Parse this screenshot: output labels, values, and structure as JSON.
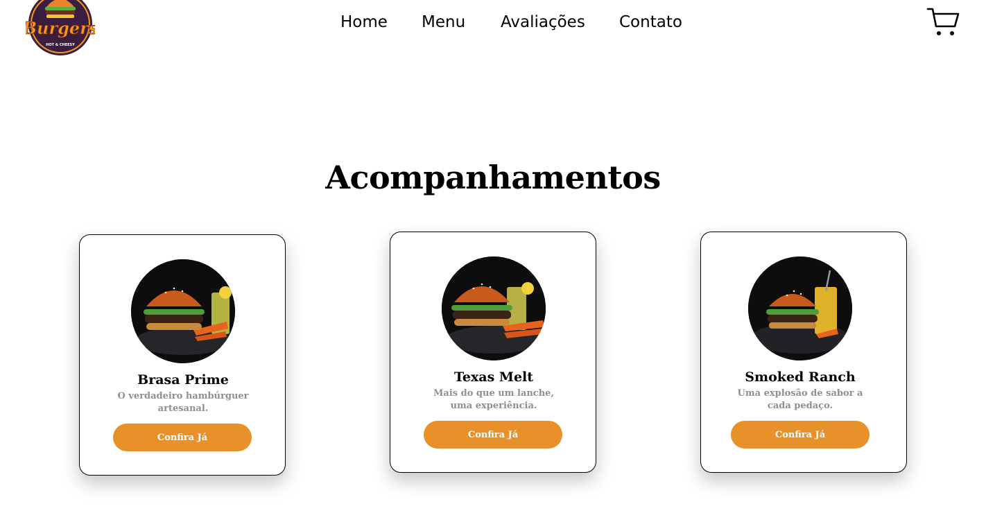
{
  "brand": {
    "logo_text": "Burgers",
    "logo_tagline": "HOT & CHEESY"
  },
  "nav": {
    "items": [
      {
        "label": "Home"
      },
      {
        "label": "Menu"
      },
      {
        "label": "Avaliações"
      },
      {
        "label": "Contato"
      }
    ]
  },
  "cart": {
    "icon": "shopping-cart-icon"
  },
  "section": {
    "title": "Acompanhamentos"
  },
  "cards": [
    {
      "name": "Brasa Prime",
      "description": "O verdadeiro hambúrguer artesanal.",
      "button": "Confira Já"
    },
    {
      "name": "Texas Melt",
      "description": "Mais do que um lanche, uma experiência.",
      "button": "Confira Já"
    },
    {
      "name": "Smoked Ranch",
      "description": "Uma explosão de sabor a cada pedaço.",
      "button": "Confira Já"
    }
  ],
  "colors": {
    "accent": "#e8912b",
    "description_text": "#8f8f8f",
    "logo_dark": "#3a1d3f",
    "logo_orange": "#f39a1e"
  }
}
